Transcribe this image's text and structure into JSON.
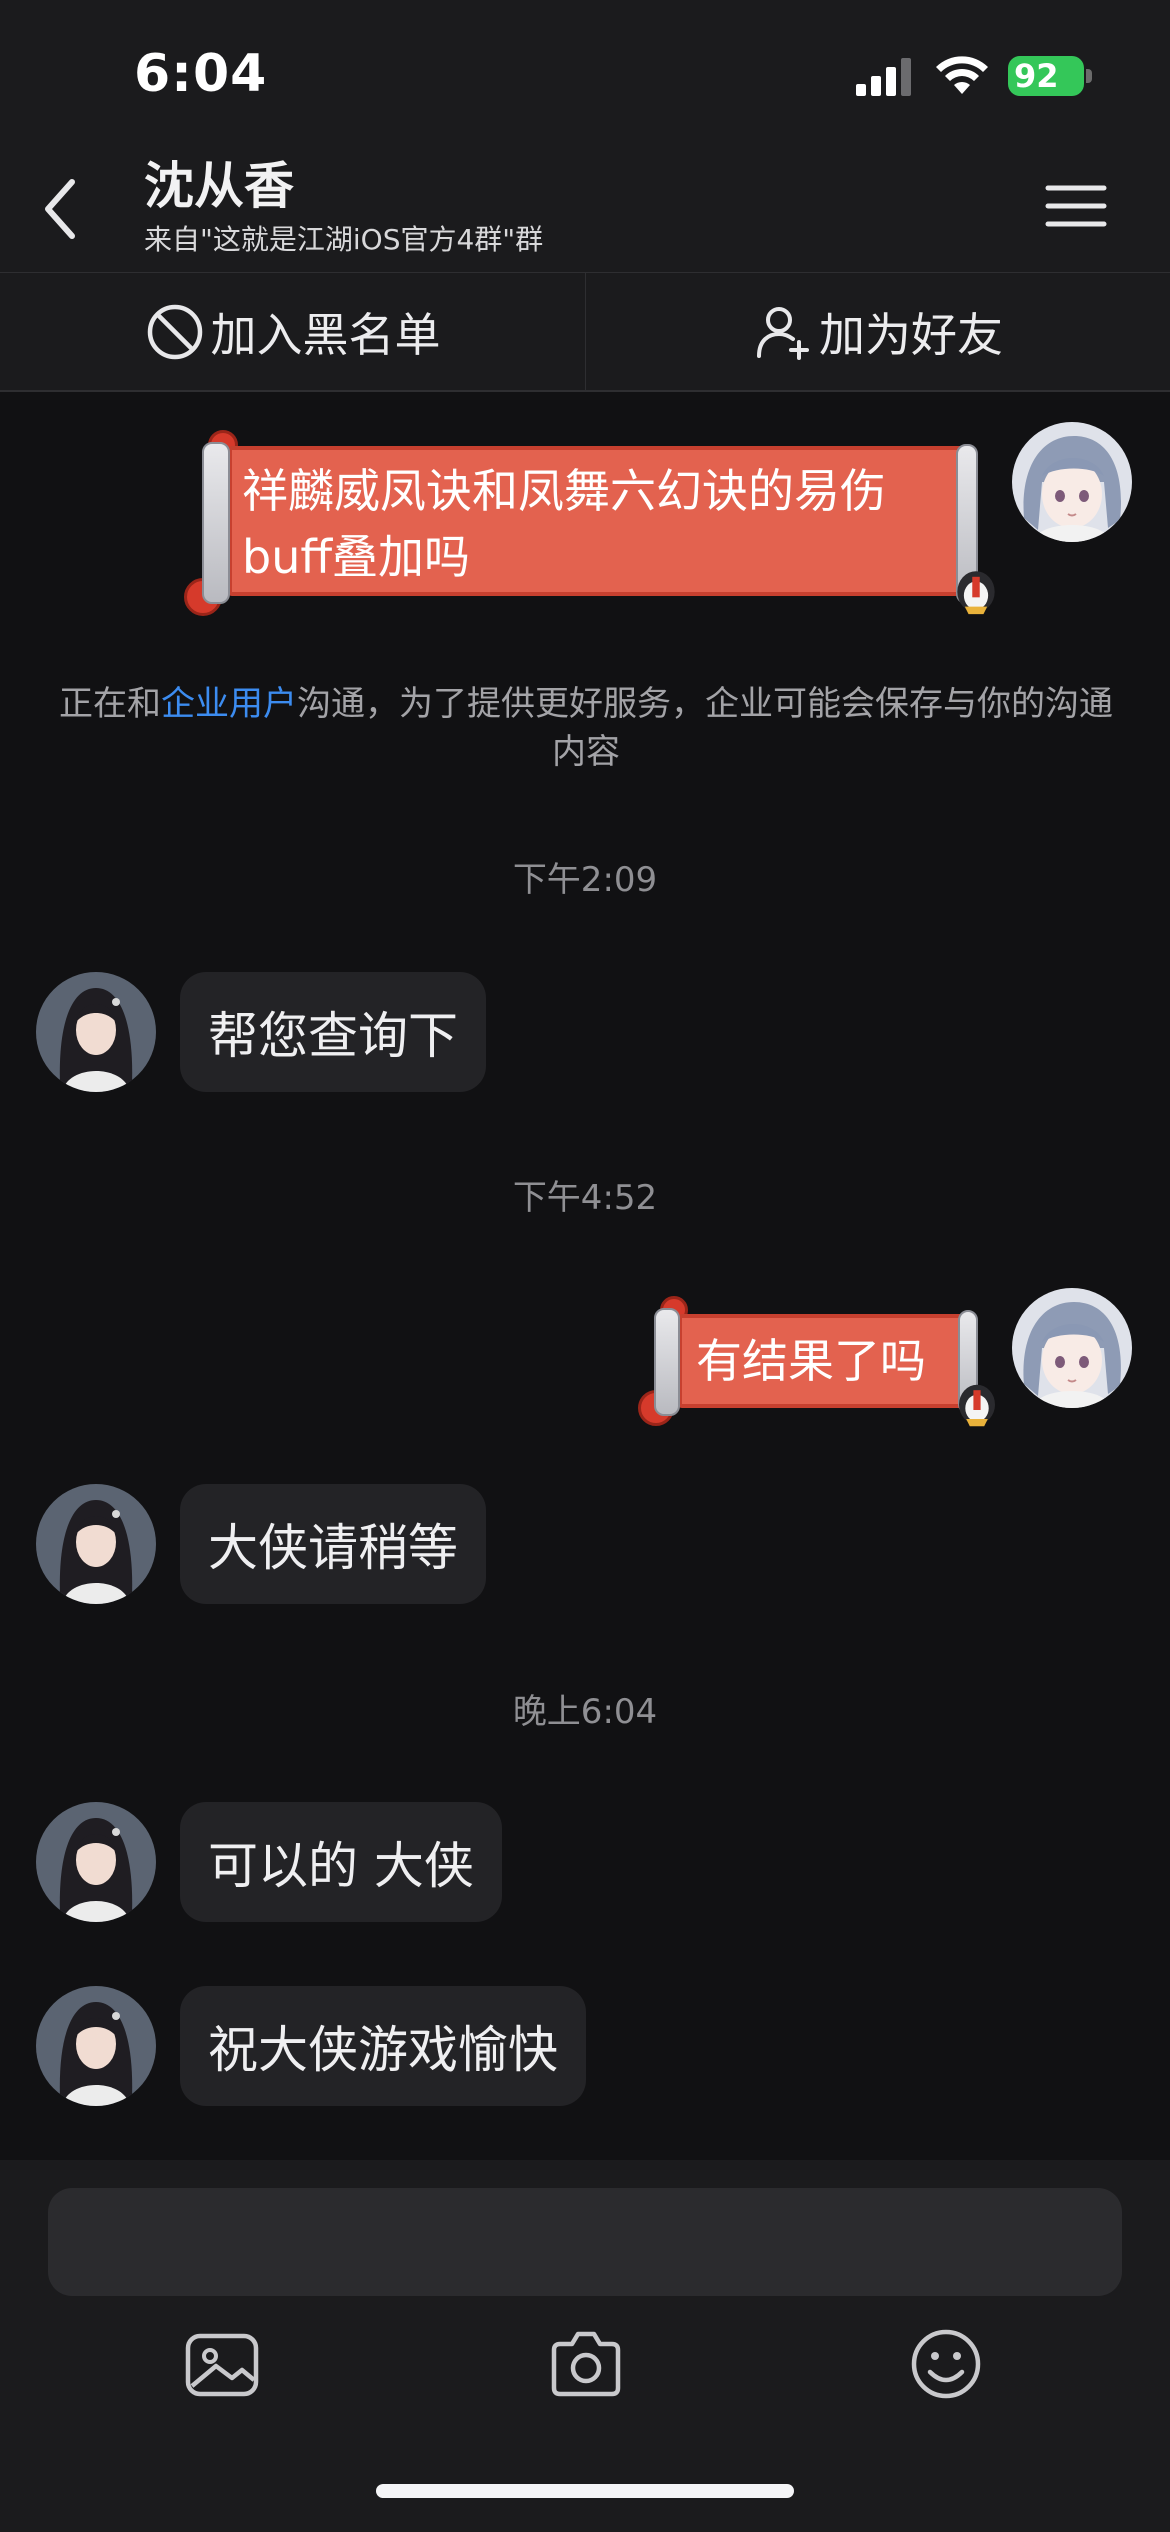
{
  "status_bar": {
    "time": "6:04",
    "battery_percent": "92",
    "battery_color": "#34c759"
  },
  "header": {
    "back_icon": "chevron-left-icon",
    "title": "沈从香",
    "subtitle": "来自\"这就是江湖iOS官方4群\"群",
    "menu_icon": "hamburger-menu-icon"
  },
  "actions": {
    "blacklist_label": "加入黑名单",
    "blacklist_icon": "block-icon",
    "add_friend_label": "加为好友",
    "add_friend_icon": "add-user-icon"
  },
  "messages": {
    "sent_1": "祥麟威凤诀和凤舞六幻诀的易伤\nbuff叠加吗",
    "sent_2": "有结果了吗",
    "time_1": "下午2:09",
    "time_2": "下午4:52",
    "time_3": "晚上6:04",
    "recv_1": "帮您查询下",
    "recv_2": "大侠请稍等",
    "recv_3": "可以的 大侠",
    "recv_4": "祝大侠游戏愉快"
  },
  "notice": {
    "prefix": "正在和",
    "link": "企业用户",
    "suffix": "沟通，为了提供更好服务，企业可能会保存与你的沟通内容"
  },
  "composer": {
    "placeholder": "",
    "tools": [
      "image-icon",
      "camera-icon",
      "emoji-icon"
    ]
  },
  "colors": {
    "background": "#111113",
    "panel": "#1b1b1d",
    "bubble": "#232326",
    "scroll_bubble": "#e3624f",
    "link": "#3c8cf0"
  }
}
